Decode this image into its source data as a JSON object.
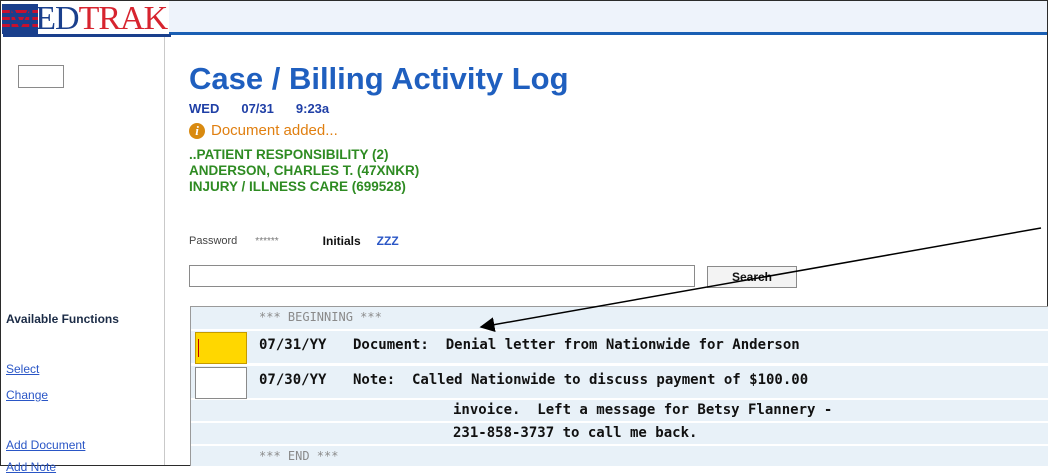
{
  "app": {
    "logo_text_a": "MED",
    "logo_text_b": "TRAK"
  },
  "page": {
    "title": "Case / Billing Activity Log",
    "day": "WED",
    "date": "07/31",
    "time": "9:23a",
    "status_message": "Document added...",
    "case_lines": [
      "..PATIENT RESPONSIBILITY (2)",
      "ANDERSON, CHARLES T. (47XNKR)",
      "INJURY / ILLNESS CARE (699528)"
    ]
  },
  "auth": {
    "password_label": "Password",
    "password_mask": "******",
    "initials_label": "Initials",
    "initials_value": "ZZZ"
  },
  "search": {
    "value": "",
    "button_label": "Search"
  },
  "sidebar": {
    "heading": "Available Functions",
    "links": [
      "Select",
      "Change",
      "Add Document",
      "Add Note"
    ]
  },
  "log": {
    "beginning_marker": "*** BEGINNING ***",
    "end_marker": "*** END ***",
    "entries": [
      {
        "date": "07/31/YY",
        "text": "Document:  Denial letter from Nationwide for Anderson"
      },
      {
        "date": "07/30/YY",
        "text": "Note:  Called Nationwide to discuss payment of $100.00"
      }
    ],
    "continuation": [
      "invoice.  Left a message for Betsy Flannery -",
      "231-858-3737 to call me back."
    ]
  },
  "colors": {
    "title": "#1f5fbf",
    "status": "#e07f10",
    "case": "#2e8b22",
    "selected_row": "#ffd700",
    "link": "#2a56c6"
  }
}
